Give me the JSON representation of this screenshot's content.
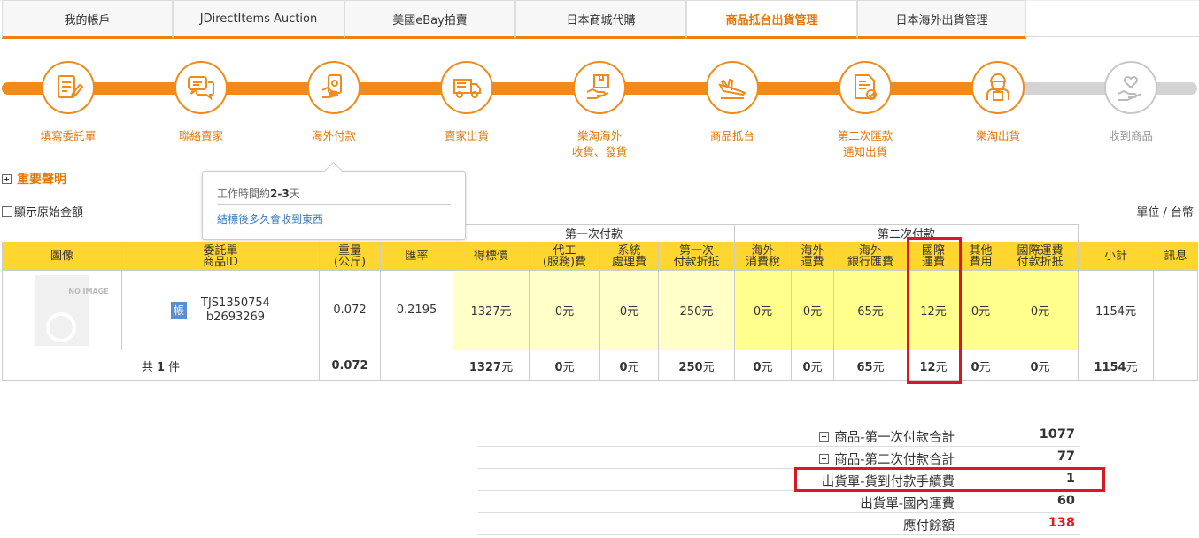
{
  "tabs": [
    {
      "label": "我的帳戶"
    },
    {
      "label": "JDirectItems Auction"
    },
    {
      "label": "美國eBay拍賣"
    },
    {
      "label": "日本商城代購"
    },
    {
      "label": "商品抵台出貨管理"
    },
    {
      "label": "日本海外出貨管理"
    }
  ],
  "steps": [
    {
      "label": "填寫委託單",
      "icon": "form-edit-icon"
    },
    {
      "label": "聯絡賣家",
      "icon": "chat-bubbles-icon"
    },
    {
      "label": "海外付款",
      "icon": "money-payment-icon"
    },
    {
      "label": "賣家出貨",
      "icon": "delivery-truck-icon"
    },
    {
      "label": "樂淘海外\n收貨、發貨",
      "icon": "package-hand-icon"
    },
    {
      "label": "商品抵台",
      "icon": "airplane-icon"
    },
    {
      "label": "第二次匯款\n通知出貨",
      "icon": "document-check-icon"
    },
    {
      "label": "樂淘出貨",
      "icon": "courier-icon"
    },
    {
      "label": "收到商品",
      "icon": "heart-hand-icon"
    }
  ],
  "tooltip": {
    "line1_prefix": "工作時間約",
    "line1_bold": "2-3",
    "line1_suffix": "天",
    "line2": "結標後多久會收到東西"
  },
  "notice": "重要聲明",
  "show_original": "顯示原始金額",
  "unit": "單位 / 台幣",
  "table": {
    "group1": "第一次付款",
    "group2": "第二次付款",
    "headers": {
      "image": "圖像",
      "order_id": "委託單\n商品ID",
      "weight": "重量\n(公斤)",
      "rate": "匯率",
      "bid": "得標價",
      "agency_fee": "代工\n(服務)費",
      "system_fee": "系統\n處理費",
      "first_discount": "第一次\n付款折抵",
      "overseas_tax": "海外\n消費稅",
      "overseas_shipping": "海外\n運費",
      "overseas_bank": "海外\n銀行匯費",
      "intl_shipping": "國際\n運費",
      "other": "其他\n費用",
      "intl_discount": "國際運費\n付款折抵",
      "subtotal": "小計",
      "message": "訊息"
    },
    "row": {
      "no_image": "NO IMAGE",
      "account_badge": "帳",
      "order_no": "TJS1350754",
      "item_id": "b2693269",
      "weight": "0.072",
      "rate": "0.2195",
      "bid": "1327元",
      "agency_fee": "0元",
      "system_fee": "0元",
      "first_discount": "250元",
      "overseas_tax": "0元",
      "overseas_shipping": "0元",
      "overseas_bank": "65元",
      "intl_shipping": "12元",
      "other": "0元",
      "intl_discount": "0元",
      "subtotal": "1154元"
    },
    "total": {
      "count_prefix": "共 ",
      "count": "1",
      "count_suffix": " 件",
      "weight": "0.072",
      "bid": "1327",
      "agency_fee": "0",
      "system_fee": "0",
      "first_discount": "250",
      "overseas_tax": "0",
      "overseas_shipping": "0",
      "overseas_bank": "65",
      "intl_shipping": "12",
      "other": "0",
      "intl_discount": "0",
      "subtotal": "1154",
      "currency": "元"
    }
  },
  "summary": [
    {
      "label": "商品-第一次付款合計",
      "value": "1077",
      "expandable": true
    },
    {
      "label": "商品-第二次付款合計",
      "value": "77",
      "expandable": true
    },
    {
      "label": "出貨單-貨到付款手續費",
      "value": "1",
      "expandable": false
    },
    {
      "label": "出貨單-國內運費",
      "value": "60",
      "expandable": false
    },
    {
      "label": "應付餘額",
      "value": "138",
      "expandable": false,
      "highlight": "#e01b1b"
    }
  ],
  "colors": {
    "accent": "#ee8010",
    "header_yellow": "#ffd530",
    "highlight_red": "#d9181f"
  }
}
